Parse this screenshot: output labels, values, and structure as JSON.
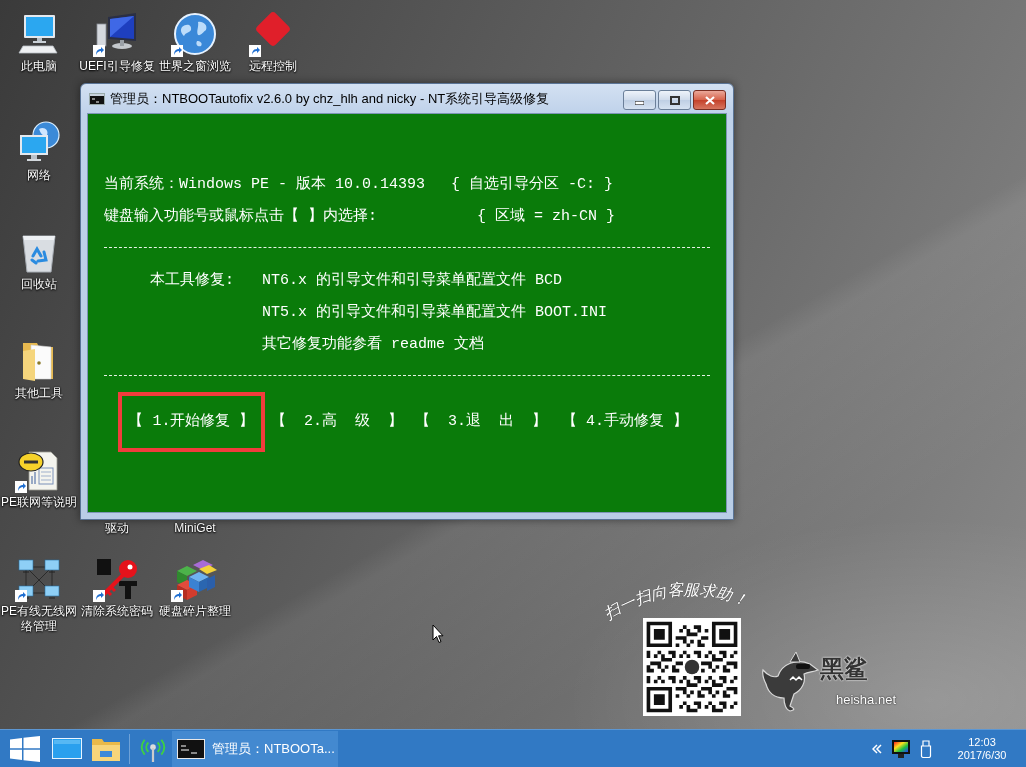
{
  "desktop_icons": [
    {
      "label": "此电脑",
      "kind": "computer",
      "shortcut": false
    },
    {
      "label": "UEFI引导修复",
      "kind": "uefi",
      "shortcut": true
    },
    {
      "label": "世界之窗浏览",
      "kind": "globe",
      "shortcut": true
    },
    {
      "label": "远程控制",
      "kind": "diamond",
      "shortcut": true
    },
    {
      "label": "网络",
      "kind": "network",
      "shortcut": false
    },
    {
      "label": "回收站",
      "kind": "recycle",
      "shortcut": false
    },
    {
      "label": "其他工具",
      "kind": "folder",
      "shortcut": false
    },
    {
      "label": "PE联网等说明",
      "kind": "pdf",
      "shortcut": true
    },
    {
      "label": "PE有线无线网络管理",
      "kind": "lan",
      "shortcut": true
    },
    {
      "label": "清除系统密码",
      "kind": "key",
      "shortcut": true
    },
    {
      "label": "硬盘碎片整理",
      "kind": "cubes",
      "shortcut": true
    }
  ],
  "covered_icon_labels": [
    "驱动",
    "MiniGet"
  ],
  "window": {
    "title": "管理员：NTBOOTautofix v2.6.0 by chz_hlh and nicky - NT系统引导高级修复",
    "info_lines": [
      {
        "left": "当前系统：Windows PE - 版本 10.0.14393",
        "right": "{ 自选引导分区 -C: }"
      },
      {
        "left": "键盘输入功能号或鼠标点击【 】内选择:",
        "right": "{ 区域 = zh-CN }"
      }
    ],
    "repair": {
      "label": "本工具修复:",
      "lines": [
        "NT6.x 的引导文件和引导菜单配置文件 BCD",
        "NT5.x 的引导文件和引导菜单配置文件 BOOT.INI",
        "其它修复功能参看 readme 文档"
      ]
    },
    "options": [
      {
        "label": "【 1.开始修复 】",
        "highlighted": true
      },
      {
        "label": "【  2.高  级  】",
        "highlighted": false
      },
      {
        "label": "【  3.退  出  】",
        "highlighted": false
      },
      {
        "label": "【 4.手动修复 】",
        "highlighted": false
      }
    ]
  },
  "wallpaper": {
    "slogan": "扫一扫向客服求助！",
    "brand": "黑鲨",
    "site": "heisha.net"
  },
  "taskbar": {
    "tasks": [
      {
        "label": "管理员：NTBOOTa...",
        "active": true
      }
    ],
    "clock": {
      "time": "12:03",
      "date": "2017/6/30"
    }
  }
}
